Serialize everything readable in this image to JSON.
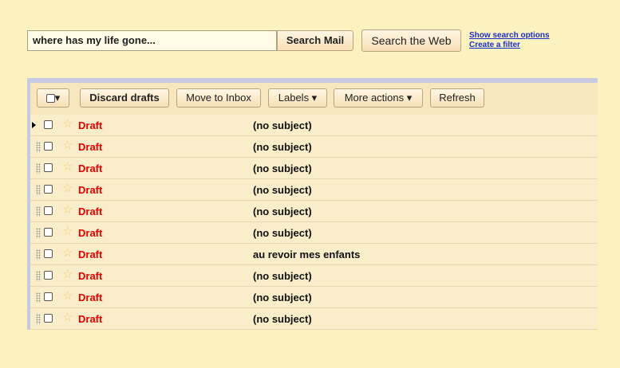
{
  "search": {
    "query": "where has my life gone...",
    "search_mail_label": "Search Mail",
    "search_web_label": "Search the Web",
    "show_options_label": "Show search options",
    "create_filter_label": "Create a filter"
  },
  "toolbar": {
    "select_label": "▾",
    "discard_label": "Discard drafts",
    "move_label": "Move to Inbox",
    "labels_label": "Labels ▾",
    "more_label": "More actions ▾",
    "refresh_label": "Refresh"
  },
  "messages": [
    {
      "sender": "Draft",
      "subject": "(no subject)"
    },
    {
      "sender": "Draft",
      "subject": "(no subject)"
    },
    {
      "sender": "Draft",
      "subject": "(no subject)"
    },
    {
      "sender": "Draft",
      "subject": "(no subject)"
    },
    {
      "sender": "Draft",
      "subject": "(no subject)"
    },
    {
      "sender": "Draft",
      "subject": "(no subject)"
    },
    {
      "sender": "Draft",
      "subject": "au revoir mes enfants"
    },
    {
      "sender": "Draft",
      "subject": "(no subject)"
    },
    {
      "sender": "Draft",
      "subject": "(no subject)"
    },
    {
      "sender": "Draft",
      "subject": "(no subject)"
    }
  ],
  "colors": {
    "background": "#fcf2bf",
    "draft_red": "#e80000",
    "link_blue": "#1c2fc9",
    "panel_border": "#c6cbe3"
  },
  "icons": [
    "checkbox-icon",
    "star-icon",
    "drag-handle-icon",
    "row-pointer-icon",
    "dropdown-arrow-icon"
  ]
}
